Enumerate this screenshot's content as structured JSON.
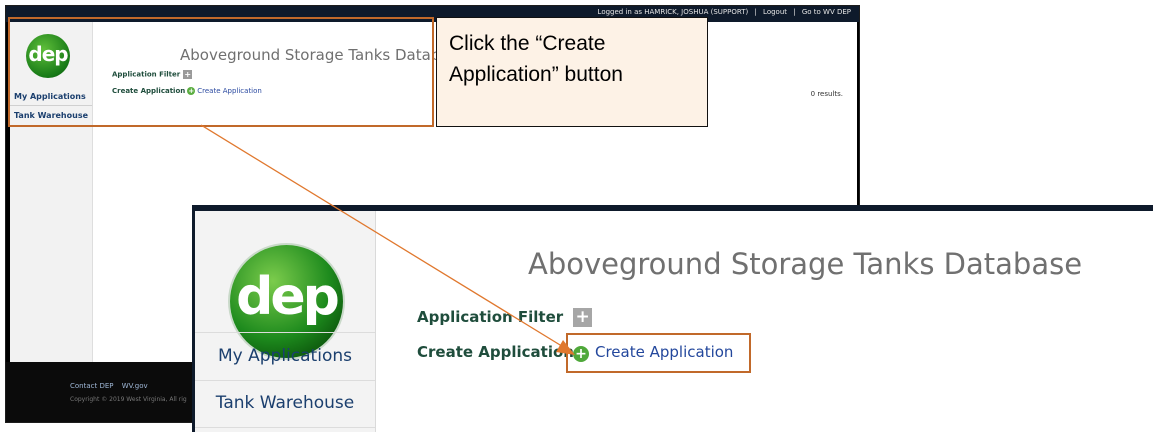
{
  "small": {
    "topbar": {
      "logged_in": "Logged in as HAMRICK, JOSHUA (SUPPORT)",
      "sep": "|",
      "logout": "Logout",
      "go_to": "Go to WV DEP"
    },
    "logo_text": "dep",
    "nav": [
      "My Applications",
      "Tank Warehouse"
    ],
    "title": "Aboveground Storage Tanks Database",
    "filter_label": "Application Filter",
    "create_label": "Create Application",
    "create_link": "Create Application",
    "results": "0 results.",
    "footer": {
      "contact": "Contact DEP",
      "wvgov": "WV.gov",
      "copyright": "Copyright © 2019 West Virginia, All rig"
    }
  },
  "callout": {
    "text": "Click the “Create Application” button"
  },
  "zoom": {
    "logo_text": "dep",
    "nav": [
      "My Applications",
      "Tank Warehouse"
    ],
    "title": "Aboveground Storage Tanks Database",
    "filter_label": "Application Filter",
    "create_label": "Create Application",
    "create_link": "Create Application"
  },
  "colors": {
    "accent": "#c1692a",
    "callout_bg": "#fdf2e6",
    "nav_text": "#1b3f6e",
    "link": "#23479c",
    "logo_green": "#1d8a1d"
  },
  "icons": {
    "plus": "+",
    "add_circle": "+"
  }
}
